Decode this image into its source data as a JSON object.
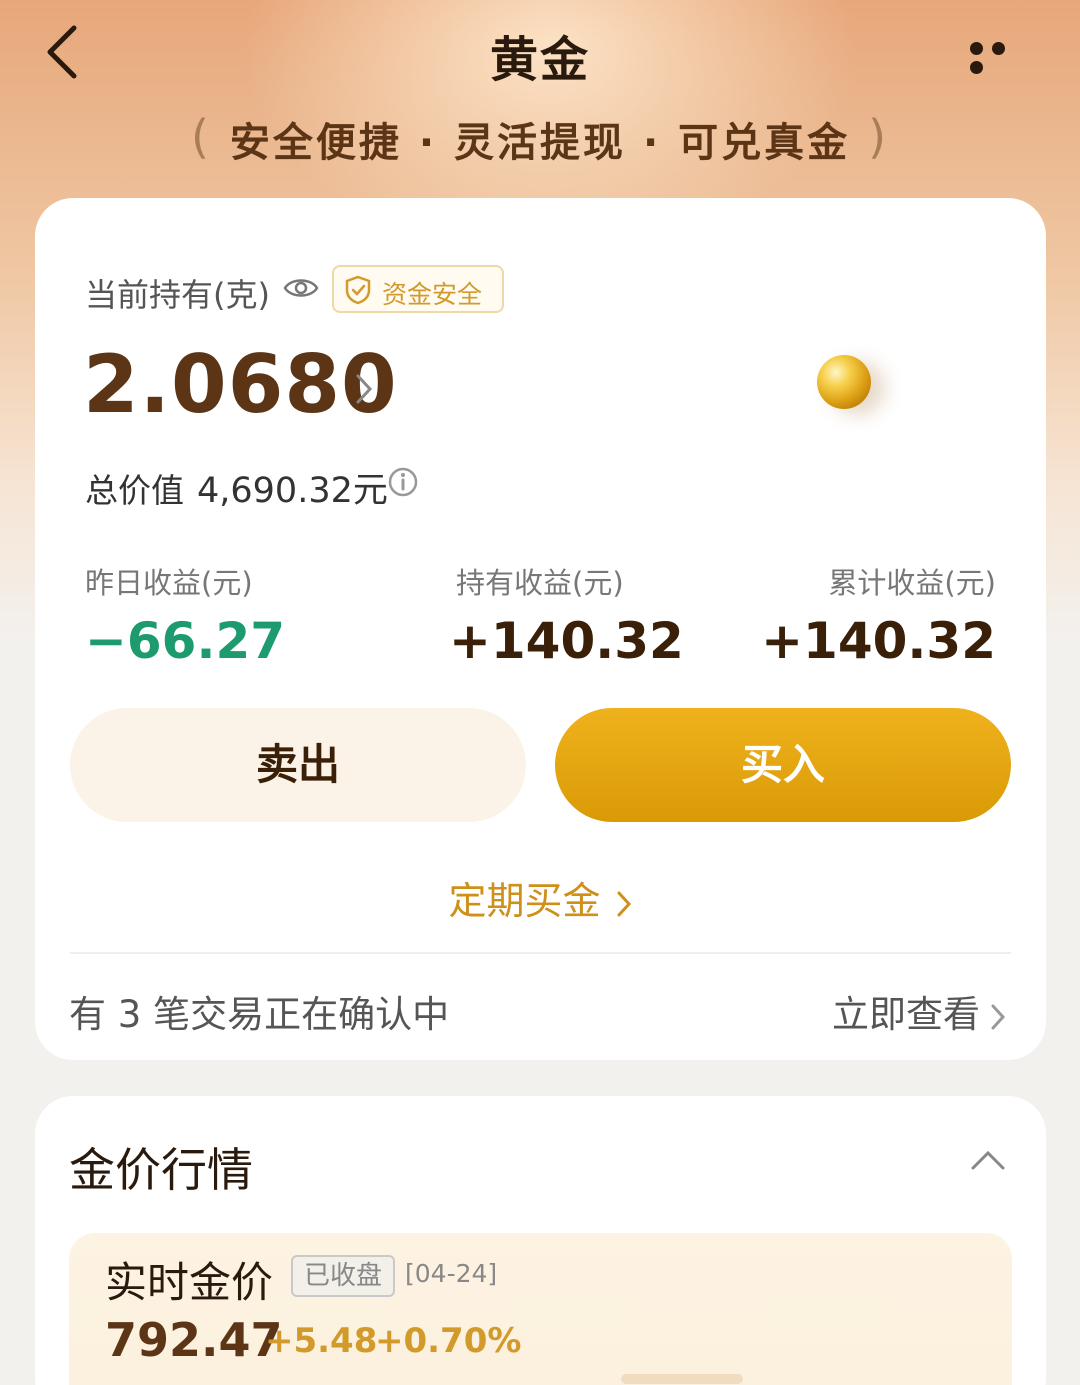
{
  "nav": {
    "title": "黄金",
    "back_icon": "chevron-left-icon",
    "more_icon": "more-dots-icon"
  },
  "slogan": {
    "item1": "安全便捷",
    "item2": "灵活提现",
    "item3": "可兑真金",
    "separator": "·"
  },
  "holding": {
    "label": "当前持有(克)",
    "badge": "资金安全",
    "grams": "2.0680",
    "total_label": "总价值",
    "total_value": "4,690.32元"
  },
  "stats": [
    {
      "label": "昨日收益(元)",
      "value": "−66.27"
    },
    {
      "label": "持有收益(元)",
      "value": "+140.32"
    },
    {
      "label": "累计收益(元)",
      "value": "+140.32"
    }
  ],
  "actions": {
    "sell": "卖出",
    "buy": "买入",
    "periodic": "定期买金"
  },
  "pending": {
    "text": "有 3 笔交易正在确认中",
    "link": "立即查看"
  },
  "market": {
    "title": "金价行情",
    "realtime_title": "实时金价",
    "status": "已收盘",
    "date": "[04-24]",
    "price": "792.47",
    "change": "+5.48",
    "change_pct": "+0.70%"
  },
  "colors": {
    "accent_gold": "#d99a06",
    "loss_green": "#1d9b6e",
    "brown_text": "#5b3516"
  }
}
